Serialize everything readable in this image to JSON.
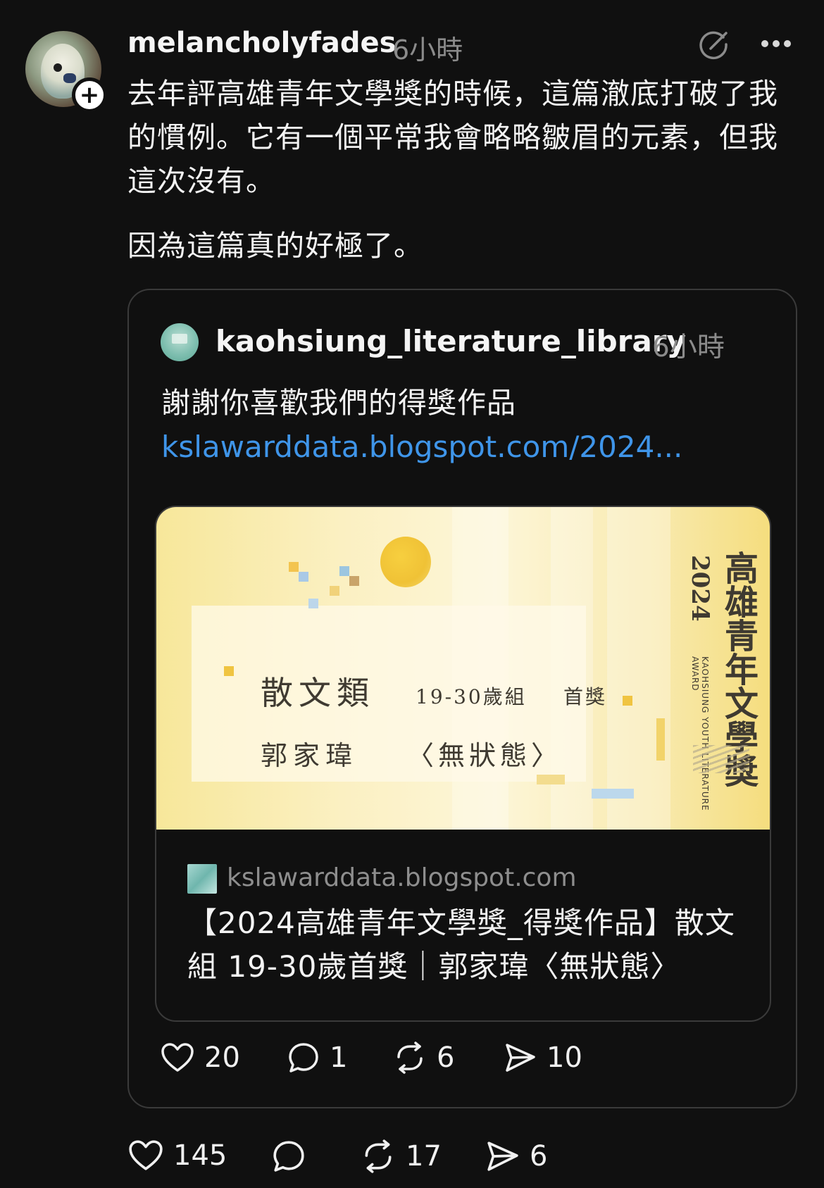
{
  "post": {
    "username": "melancholyfades",
    "time": "6小時",
    "text_p1": "去年評高雄青年文學獎的時候，這篇澈底打破了我的慣例。它有一個平常我會略略皺眉的元素，但我這次沒有。",
    "text_p2": "因為這篇真的好極了。",
    "actions": {
      "likes": "145",
      "reposts": "17",
      "shares": "6"
    }
  },
  "quoted": {
    "username": "kaohsiung_literature_library",
    "time": "6小時",
    "text": "謝謝你喜歡我們的得獎作品",
    "link": "kslawarddata.blogspot.com/2024...",
    "preview": {
      "banner": {
        "category": "散文類",
        "group": "19-30歲組",
        "prize": "首獎",
        "author": "郭家瑋",
        "work": "〈無狀態〉",
        "vertical_title": "高雄青年文學獎",
        "year": "2024",
        "english": "KAOHSIUNG YOUTH LITERATURE AWARD"
      },
      "domain": "kslawarddata.blogspot.com",
      "title": "【2024高雄青年文學獎_得獎作品】散文組 19-30歲首獎｜郭家瑋〈無狀態〉"
    },
    "actions": {
      "likes": "20",
      "replies": "1",
      "reposts": "6",
      "shares": "10"
    }
  },
  "icons": {
    "heart": "heart-icon",
    "reply": "reply-icon",
    "repost": "repost-icon",
    "share": "share-icon",
    "more": "more-icon",
    "edit": "edit-icon",
    "follow": "plus-icon"
  },
  "colors": {
    "background": "#101010",
    "link": "#3f95e9",
    "muted": "#8b8b8b",
    "border": "#3a3a3a"
  }
}
